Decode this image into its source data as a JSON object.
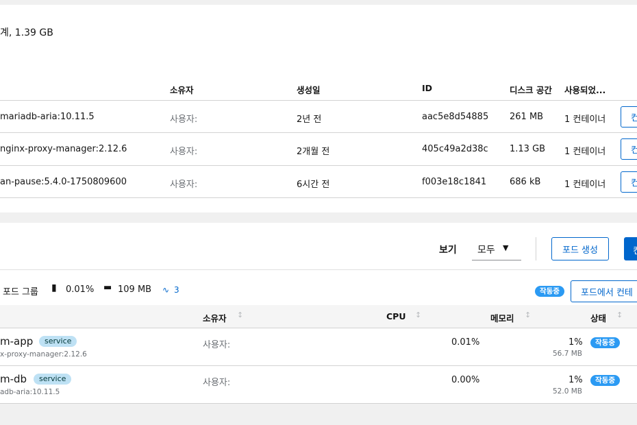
{
  "images": {
    "summary": "계, 1.39 GB",
    "columns": {
      "owner": "소유자",
      "created": "생성일",
      "id": "ID",
      "disk": "디스크 공간",
      "used": "사용되었..."
    },
    "rows": [
      {
        "name": "mariadb-aria:10.11.5",
        "owner": "사용자:",
        "created": "2년 전",
        "id": "aac5e8d54885",
        "disk": "261 MB",
        "used": "1 컨테이너",
        "action": "컨"
      },
      {
        "name": "nginx-proxy-manager:2.12.6",
        "owner": "사용자:",
        "created": "2개월 전",
        "id": "405c49a2d38c",
        "disk": "1.13 GB",
        "used": "1 컨테이너",
        "action": "컨"
      },
      {
        "name": "an-pause:5.4.0-1750809600",
        "owner": "사용자:",
        "created": "6시간 전",
        "id": "f003e18c1841",
        "disk": "686 kB",
        "used": "1 컨테이너",
        "action": "컨"
      }
    ]
  },
  "pods": {
    "view_label": "보기",
    "view_select": "모두",
    "create_pod_label": "포드 생성",
    "primary_btn_label": "컨",
    "group": {
      "label": "포드 그룹",
      "cpu": "0.01%",
      "memory": "109 MB",
      "activity": "3",
      "status": "작동중",
      "action_label": "포드에서 컨테"
    },
    "columns": {
      "owner": "소유자",
      "cpu": "CPU",
      "memory": "메모리",
      "status": "상태"
    },
    "rows": [
      {
        "name": "m-app",
        "tag": "service",
        "image": "x-proxy-manager:2.12.6",
        "owner": "사용자:",
        "cpu": "0.01%",
        "mem_pct": "1%",
        "mem": "56.7 MB",
        "status": "작동중"
      },
      {
        "name": "m-db",
        "tag": "service",
        "image": "adb-aria:10.11.5",
        "owner": "사용자:",
        "cpu": "0.00%",
        "mem_pct": "1%",
        "mem": "52.0 MB",
        "status": "작동중"
      }
    ]
  },
  "colors": {
    "accent": "#0066cc",
    "running": "#2b9af3",
    "service": "#bee1f4"
  }
}
